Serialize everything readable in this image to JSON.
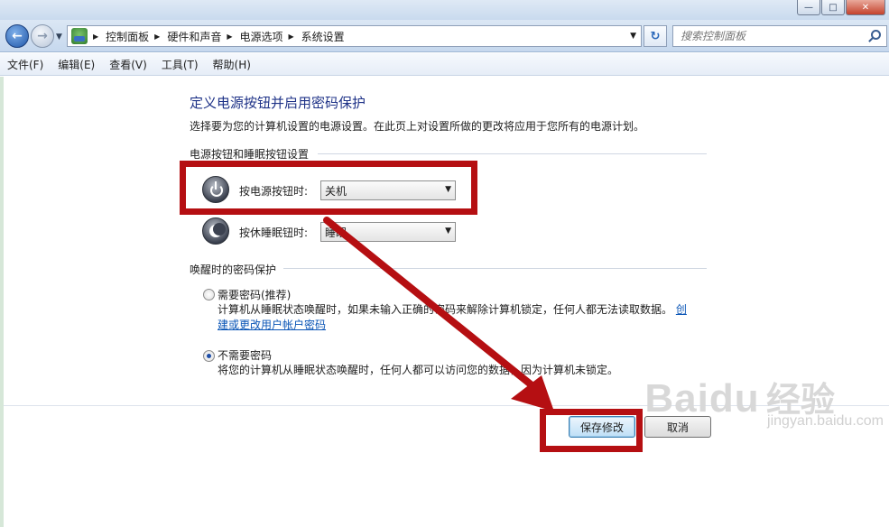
{
  "window": {
    "minimize_label": "—",
    "maximize_label": "□",
    "close_label": "✕"
  },
  "navigation": {
    "back_label": "←",
    "forward_label": "→",
    "breadcrumbs": [
      "控制面板",
      "硬件和声音",
      "电源选项",
      "系统设置"
    ],
    "refresh_label": "↻",
    "search_placeholder": "搜索控制面板"
  },
  "menubar": {
    "items": [
      "文件(F)",
      "编辑(E)",
      "查看(V)",
      "工具(T)",
      "帮助(H)"
    ]
  },
  "page": {
    "title": "定义电源按钮并启用密码保护",
    "description": "选择要为您的计算机设置的电源设置。在此页上对设置所做的更改将应用于您所有的电源计划。"
  },
  "power_section": {
    "header": "电源按钮和睡眠按钮设置",
    "power_button_label": "按电源按钮时:",
    "power_button_value": "关机",
    "sleep_button_label": "按休睡眠钮时:",
    "sleep_button_value": "睡眠"
  },
  "password_section": {
    "header": "唤醒时的密码保护",
    "require_label": "需要密码(推荐)",
    "require_desc": "计算机从睡眠状态唤醒时，如果未输入正确的密码来解除计算机锁定，任何人都无法读取数据。",
    "require_link_part1": "创",
    "require_link_part2": "建或更改用户帐户密码",
    "no_require_label": "不需要密码",
    "no_require_desc": "将您的计算机从睡眠状态唤醒时，任何人都可以访问您的数据，因为计算机未锁定。",
    "selected": "no_require"
  },
  "buttons": {
    "save_label": "保存修改",
    "cancel_label": "取消"
  },
  "watermark": {
    "logo": "Baidu",
    "text": "经验",
    "url": "jingyan.baidu.com"
  },
  "colors": {
    "title_blue": "#1e3287",
    "annotation_red": "#b50f12",
    "link_blue": "#0a55b6"
  }
}
